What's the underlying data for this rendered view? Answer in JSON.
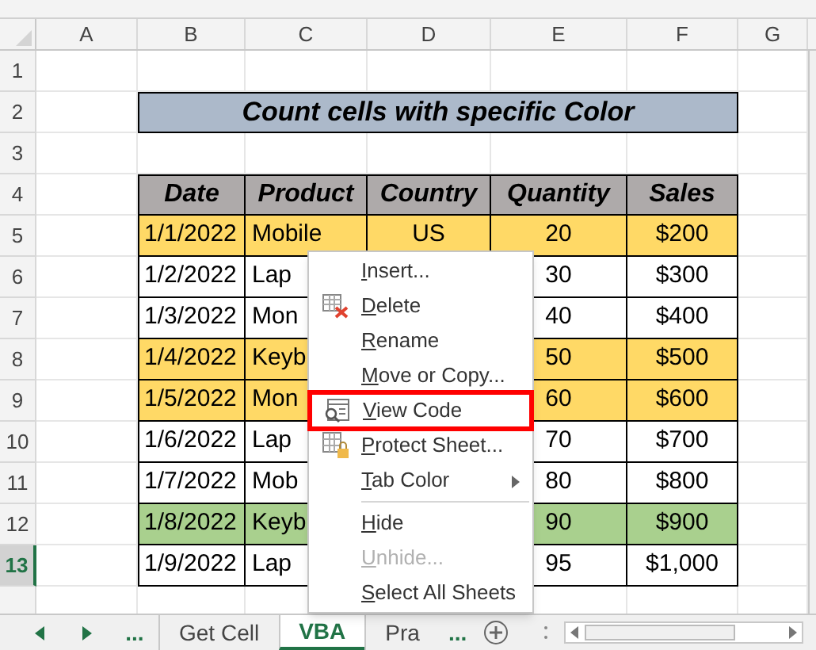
{
  "columns": [
    "A",
    "B",
    "C",
    "D",
    "E",
    "F",
    "G"
  ],
  "rows": [
    {
      "label": "1",
      "selected": false
    },
    {
      "label": "2",
      "selected": false
    },
    {
      "label": "3",
      "selected": false
    },
    {
      "label": "4",
      "selected": false
    },
    {
      "label": "5",
      "selected": false
    },
    {
      "label": "6",
      "selected": false
    },
    {
      "label": "7",
      "selected": false
    },
    {
      "label": "8",
      "selected": false
    },
    {
      "label": "9",
      "selected": false
    },
    {
      "label": "10",
      "selected": false
    },
    {
      "label": "11",
      "selected": false
    },
    {
      "label": "12",
      "selected": false
    },
    {
      "label": "13",
      "selected": true
    }
  ],
  "title": "Count cells with specific Color",
  "table": {
    "columns": [
      "Date",
      "Product",
      "Country",
      "Quantity",
      "Sales"
    ],
    "rows": [
      {
        "color": "#ffd966",
        "cells": [
          "1/1/2022",
          "Mobile",
          "US",
          "20",
          "$200"
        ]
      },
      {
        "color": "#ffffff",
        "cells": [
          "1/2/2022",
          "Lap",
          "",
          "30",
          "$300"
        ]
      },
      {
        "color": "#ffffff",
        "cells": [
          "1/3/2022",
          "Mon",
          "",
          "40",
          "$400"
        ]
      },
      {
        "color": "#ffd966",
        "cells": [
          "1/4/2022",
          "Keyb",
          "",
          "50",
          "$500"
        ]
      },
      {
        "color": "#ffd966",
        "cells": [
          "1/5/2022",
          "Mon",
          "",
          "60",
          "$600"
        ]
      },
      {
        "color": "#ffffff",
        "cells": [
          "1/6/2022",
          "Lap",
          "",
          "70",
          "$700"
        ]
      },
      {
        "color": "#ffffff",
        "cells": [
          "1/7/2022",
          "Mob",
          "",
          "80",
          "$800"
        ]
      },
      {
        "color": "#a9d08e",
        "cells": [
          "1/8/2022",
          "Keyb",
          "",
          "90",
          "$900"
        ]
      },
      {
        "color": "#ffffff",
        "cells": [
          "1/9/2022",
          "Lap",
          "",
          "95",
          "$1,000"
        ]
      }
    ]
  },
  "context_menu": [
    {
      "label": "Insert...",
      "kind": "plain",
      "disabled": false,
      "highlighted": false,
      "submenu": false
    },
    {
      "label": "Delete",
      "kind": "delete",
      "disabled": false,
      "highlighted": false,
      "submenu": false
    },
    {
      "label": "Rename",
      "kind": "plain",
      "disabled": false,
      "highlighted": false,
      "submenu": false
    },
    {
      "label": "Move or Copy...",
      "kind": "plain",
      "disabled": false,
      "highlighted": false,
      "submenu": false
    },
    {
      "label": "View Code",
      "kind": "code",
      "disabled": false,
      "highlighted": true,
      "submenu": false
    },
    {
      "label": "Protect Sheet...",
      "kind": "protect",
      "disabled": false,
      "highlighted": false,
      "submenu": false
    },
    {
      "label": "Tab Color",
      "kind": "plain",
      "disabled": false,
      "highlighted": false,
      "submenu": true
    },
    {
      "label": "Hide",
      "kind": "plain",
      "disabled": false,
      "highlighted": false,
      "submenu": false,
      "separator_before": true
    },
    {
      "label": "Unhide...",
      "kind": "plain",
      "disabled": true,
      "highlighted": false,
      "submenu": false
    },
    {
      "label": "Select All Sheets",
      "kind": "plain",
      "disabled": false,
      "highlighted": false,
      "submenu": false
    }
  ],
  "sheet_tabs": {
    "more_left": "...",
    "tabs": [
      {
        "label": "Get Cell",
        "selected": false
      },
      {
        "label": "VBA",
        "selected": true
      },
      {
        "label": "Pra",
        "selected": false
      }
    ],
    "more_right": "..."
  }
}
